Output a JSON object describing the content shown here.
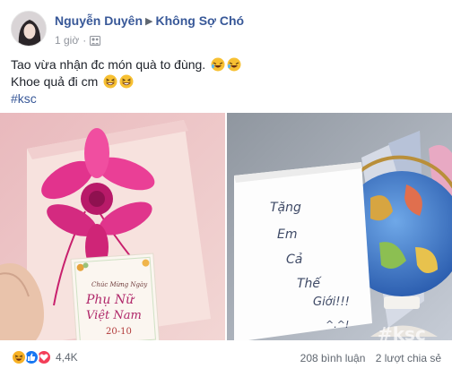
{
  "post": {
    "author": "Nguyễn Duyên",
    "group": "Không Sợ Chó",
    "time": "1 giờ",
    "separator": "·",
    "privacy_icon": "group-icon",
    "lines": [
      "Tao vừa nhận đc món quà to đùng.",
      "Khoe quả đi cm",
      "#ksc"
    ],
    "emojis": [
      "rolling-on-floor-laughing",
      "grinning-squinting"
    ]
  },
  "photos": {
    "left": {
      "card_text_1": "Chúc Mừng Ngày",
      "card_text_2": "Phụ Nữ",
      "card_text_3": "Việt Nam",
      "card_text_4": "20-10"
    },
    "right": {
      "card_text": [
        "Tặng",
        "Em",
        "Cả",
        "Thế",
        "Giới!!!",
        "^.^!"
      ],
      "watermark": "#ksc"
    }
  },
  "footer": {
    "reactions": [
      "haha",
      "like",
      "love"
    ],
    "reaction_count": "4,4K",
    "comments": "208 bình luận",
    "shares": "2 lượt chia sẻ"
  },
  "colors": {
    "link": "#385898",
    "meta": "#90949c",
    "text": "#1d2129",
    "like": "#1877f2",
    "love": "#f33e58",
    "haha": "#f7b125"
  }
}
